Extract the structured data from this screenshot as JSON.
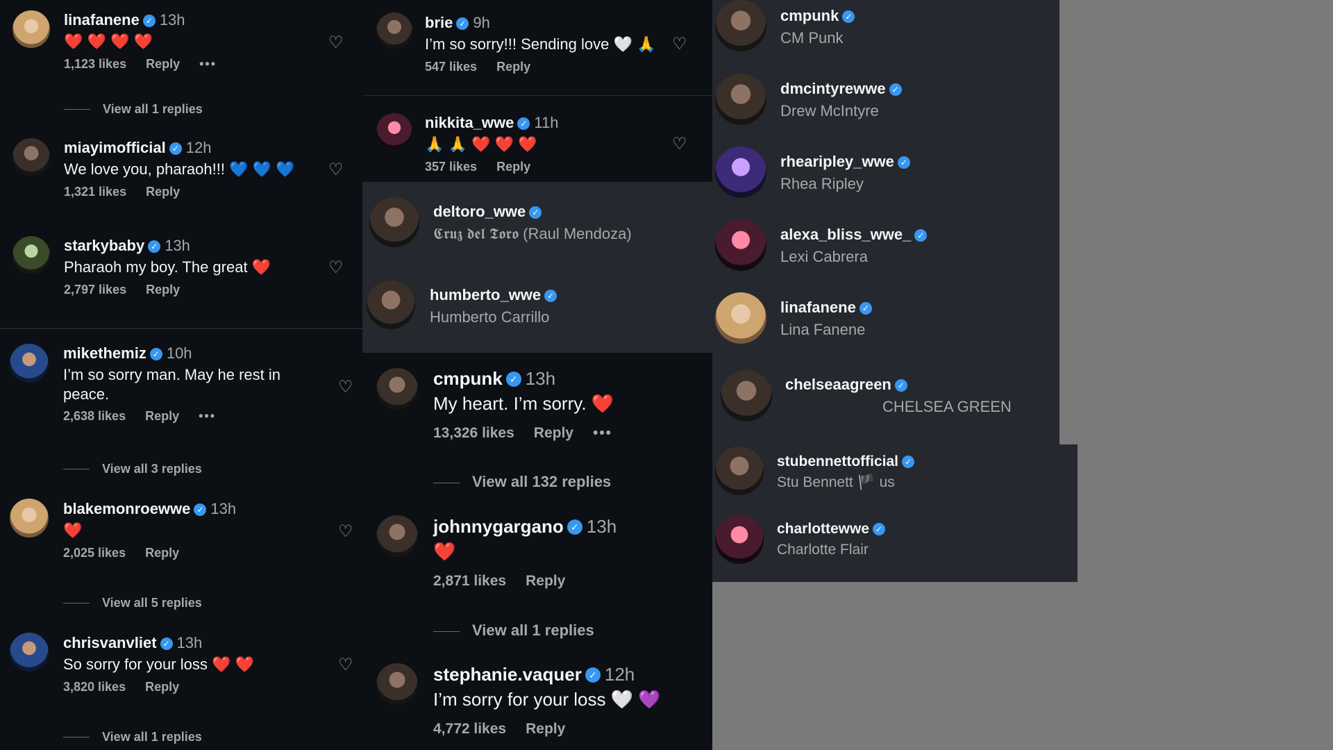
{
  "col1": {
    "comments": [
      {
        "user": "linafanene",
        "time": "13h",
        "text": "❤️ ❤️ ❤️ ❤️",
        "likes": "1,123 likes",
        "reply": "Reply",
        "more": "•••",
        "view": "View all 1 replies"
      },
      {
        "user": "miayimofficial",
        "time": "12h",
        "text": "We love you, pharaoh!!! 💙 💙 💙",
        "likes": "1,321 likes",
        "reply": "Reply"
      },
      {
        "user": "starkybaby",
        "time": "13h",
        "text": "Pharaoh my boy. The great ❤️",
        "likes": "2,797 likes",
        "reply": "Reply"
      },
      {
        "user": "mikethemiz",
        "time": "10h",
        "text": "I’m so sorry man. May he rest in peace.",
        "likes": "2,638 likes",
        "reply": "Reply",
        "more": "•••",
        "view": "View all 3 replies"
      },
      {
        "user": "blakemonroewwe",
        "time": "13h",
        "text": "❤️",
        "likes": "2,025 likes",
        "reply": "Reply",
        "view": "View all 5 replies"
      },
      {
        "user": "chrisvanvliet",
        "time": "13h",
        "text": "So sorry for your loss ❤️ ❤️",
        "likes": "3,820 likes",
        "reply": "Reply",
        "view": "View all 1 replies"
      }
    ]
  },
  "col2": {
    "comments_top": [
      {
        "user": "brie",
        "time": "9h",
        "text": "I’m so sorry!!! Sending love 🤍 🙏",
        "likes": "547 likes",
        "reply": "Reply"
      },
      {
        "user": "nikkita_wwe",
        "time": "11h",
        "text": "🙏 🙏 ❤️ ❤️ ❤️",
        "likes": "357 likes",
        "reply": "Reply"
      }
    ],
    "suggestions": [
      {
        "user": "deltoro_wwe",
        "name": "𝕮𝖗𝖚𝖟 𝖉𝖊𝖑 𝕿𝖔𝖗𝖔 (Raul Mendoza)"
      },
      {
        "user": "humberto_wwe",
        "name": "Humberto Carrillo"
      }
    ],
    "comments_bottom": [
      {
        "user": "cmpunk",
        "time": "13h",
        "text": "My heart. I’m sorry. ❤️",
        "likes": "13,326 likes",
        "reply": "Reply",
        "more": "•••",
        "view": "View all 132 replies"
      },
      {
        "user": "johnnygargano",
        "time": "13h",
        "text": "❤️",
        "likes": "2,871 likes",
        "reply": "Reply",
        "view": "View all 1 replies"
      },
      {
        "user": "stephanie.vaquer",
        "time": "12h",
        "text": "I’m sorry for your loss 🤍 💜",
        "likes": "4,772 likes",
        "reply": "Reply"
      }
    ]
  },
  "col3": {
    "accounts": [
      {
        "user": "cmpunk",
        "name": "CM Punk"
      },
      {
        "user": "dmcintyrewwe",
        "name": "Drew McIntyre"
      },
      {
        "user": "rhearipley_wwe",
        "name": "Rhea Ripley"
      },
      {
        "user": "alexa_bliss_wwe_",
        "name": "Lexi Cabrera"
      },
      {
        "user": "linafanene",
        "name": "Lina Fanene"
      },
      {
        "user": "chelseaagreen",
        "name": "CHELSEA GREEN"
      },
      {
        "user": "stubennettofficial",
        "name": "Stu Bennett 🏴 us"
      },
      {
        "user": "charlottewwe",
        "name": "Charlotte Flair"
      }
    ]
  },
  "colors": {
    "background": "#7a7a7a",
    "panel": "#0c0f14",
    "suggest_panel": "#25282e",
    "verified": "#3897f0",
    "heart": "#ff3b5c"
  }
}
